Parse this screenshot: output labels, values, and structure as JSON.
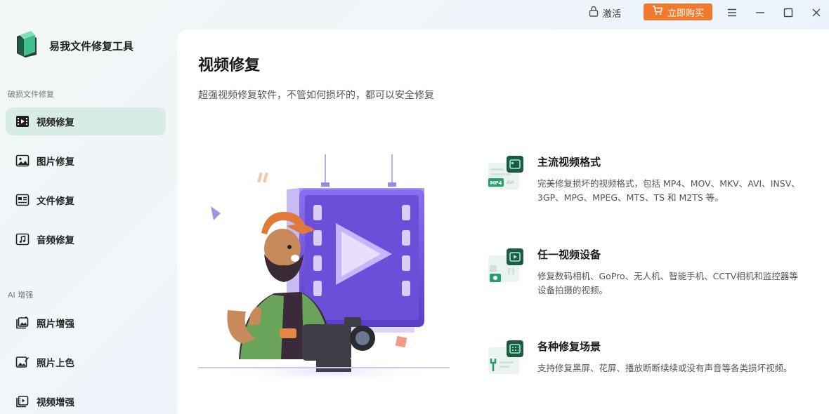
{
  "titlebar": {
    "activate_label": "激活",
    "buy_label": "立即购买",
    "buy_color": "#f07a2d"
  },
  "sidebar": {
    "app_name": "易我文件修复工具",
    "section_repair": "破损文件修复",
    "section_ai": "AI 增强",
    "repair_items": [
      {
        "label": "视频修复",
        "icon": "video-film-icon",
        "active": true
      },
      {
        "label": "图片修复",
        "icon": "image-icon",
        "active": false
      },
      {
        "label": "文件修复",
        "icon": "document-icon",
        "active": false
      },
      {
        "label": "音频修复",
        "icon": "music-note-icon",
        "active": false
      }
    ],
    "ai_items": [
      {
        "label": "照片增强",
        "icon": "photo-enhance-icon"
      },
      {
        "label": "照片上色",
        "icon": "photo-colorize-icon"
      },
      {
        "label": "视频增强",
        "icon": "video-enhance-icon"
      }
    ],
    "active_color": "#d7ece5"
  },
  "main": {
    "title": "视频修复",
    "subtitle": "超强视频修复软件，不管如何损坏的，都可以安全修复",
    "features": [
      {
        "title": "主流视频格式",
        "desc": "完美修复损坏的视频格式，包括 MP4、MOV、MKV、AVI、INSV、3GP、MPG、MPEG、MTS、TS 和 M2TS 等。",
        "icon": "video-format-icon",
        "badge": "MP4",
        "badge2": "AVI"
      },
      {
        "title": "任一视频设备",
        "desc": "修复数码相机、GoPro、无人机、智能手机、CCTV相机和监控器等设备拍摄的视频。",
        "icon": "video-device-icon"
      },
      {
        "title": "各种修复场景",
        "desc": "支持修复黑屏、花屏、播放断断续续或没有声音等各类损坏视频。",
        "icon": "repair-scenario-icon"
      }
    ],
    "accent_color": "#1f8a5c"
  }
}
